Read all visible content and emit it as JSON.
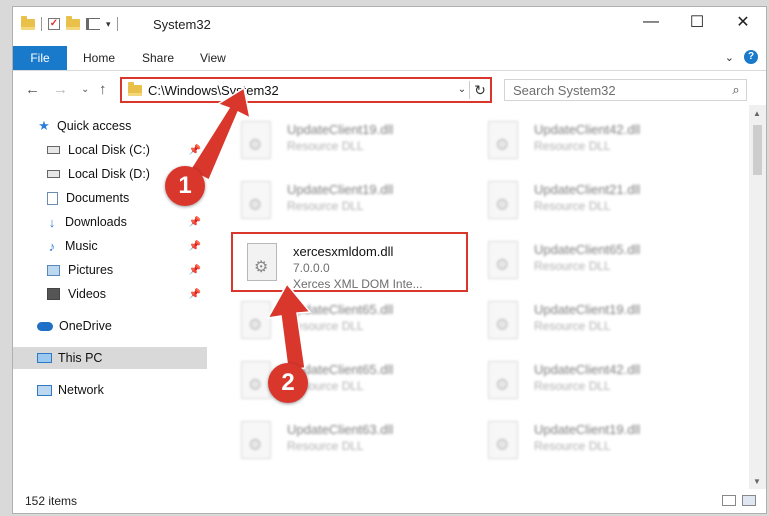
{
  "window": {
    "title": "System32"
  },
  "window_buttons": {
    "minimize": "—",
    "maximize": "☐",
    "close": "✕"
  },
  "ribbon": {
    "file_tab": "File",
    "tabs": [
      "Home",
      "Share",
      "View"
    ],
    "help": "?"
  },
  "address_bar": {
    "path": "C:\\Windows\\System32"
  },
  "search": {
    "placeholder": "Search System32"
  },
  "nav_pane": {
    "items": [
      {
        "label": "Quick access"
      },
      {
        "label": "Local Disk (C:)"
      },
      {
        "label": "Local Disk (D:)"
      },
      {
        "label": "Documents"
      },
      {
        "label": "Downloads"
      },
      {
        "label": "Music"
      },
      {
        "label": "Pictures"
      },
      {
        "label": "Videos"
      },
      {
        "label": "OneDrive"
      },
      {
        "label": "This PC"
      },
      {
        "label": "Network"
      }
    ]
  },
  "files": [
    {
      "name": "UpdateClient19.dll",
      "line2": "Resource DLL",
      "line3": ""
    },
    {
      "name": "UpdateClient42.dll",
      "line2": "Resource DLL",
      "line3": ""
    },
    {
      "name": "UpdateClient19.dll",
      "line2": "Resource DLL",
      "line3": ""
    },
    {
      "name": "UpdateClient21.dll",
      "line2": "Resource DLL",
      "line3": ""
    },
    {
      "name": "xercesxmldom.dll",
      "line2": "7.0.0.0",
      "line3": "Xerces XML DOM Inte..."
    },
    {
      "name": "UpdateClient65.dll",
      "line2": "Resource DLL",
      "line3": ""
    },
    {
      "name": "UpdateClient65.dll",
      "line2": "Resource DLL",
      "line3": ""
    },
    {
      "name": "UpdateClient19.dll",
      "line2": "Resource DLL",
      "line3": ""
    },
    {
      "name": "UpdateClient65.dll",
      "line2": "Resource DLL",
      "line3": ""
    },
    {
      "name": "UpdateClient42.dll",
      "line2": "Resource DLL",
      "line3": ""
    },
    {
      "name": "UpdateClient63.dll",
      "line2": "Resource DLL",
      "line3": ""
    },
    {
      "name": "UpdateClient19.dll",
      "line2": "Resource DLL",
      "line3": ""
    }
  ],
  "status_bar": {
    "item_count": "152 items"
  },
  "annotations": {
    "step1": "1",
    "step2": "2",
    "color": "#d9362c"
  }
}
